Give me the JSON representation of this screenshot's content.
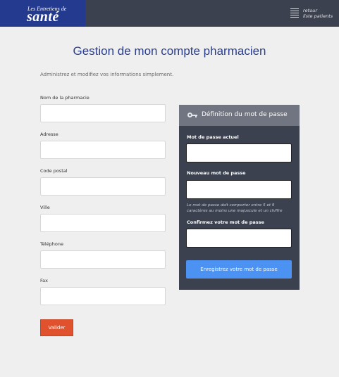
{
  "brand": {
    "line1": "Les Entretiens de",
    "line2": "santé"
  },
  "nav": {
    "back_line1": "retour",
    "back_line2": "liste patients"
  },
  "page": {
    "title": "Gestion de mon compte pharmacien",
    "subtitle": "Administrez et modifiez vos informations simplement."
  },
  "form": {
    "fields": [
      {
        "label": "Nom de la pharmacie",
        "value": ""
      },
      {
        "label": "Adresse",
        "value": ""
      },
      {
        "label": "Code postal",
        "value": ""
      },
      {
        "label": "Ville",
        "value": ""
      },
      {
        "label": "Téléphone",
        "value": ""
      },
      {
        "label": "Fax",
        "value": ""
      }
    ],
    "submit_label": "Valider"
  },
  "password": {
    "title": "Définition du mot de passe",
    "current_label": "Mot de passe actuel",
    "new_label": "Nouveau mot de passe",
    "hint": "Le mot de passe doit comporter entre 5 et 9 caractères au moins une majuscule et un chiffre",
    "confirm_label": "Confirmez votre mot de passe",
    "save_label": "Enregistrez  votre mot de passe"
  },
  "colors": {
    "brand": "#243a8e",
    "topbar": "#3c4150",
    "accent": "#e0522d",
    "save": "#4b92f2"
  }
}
